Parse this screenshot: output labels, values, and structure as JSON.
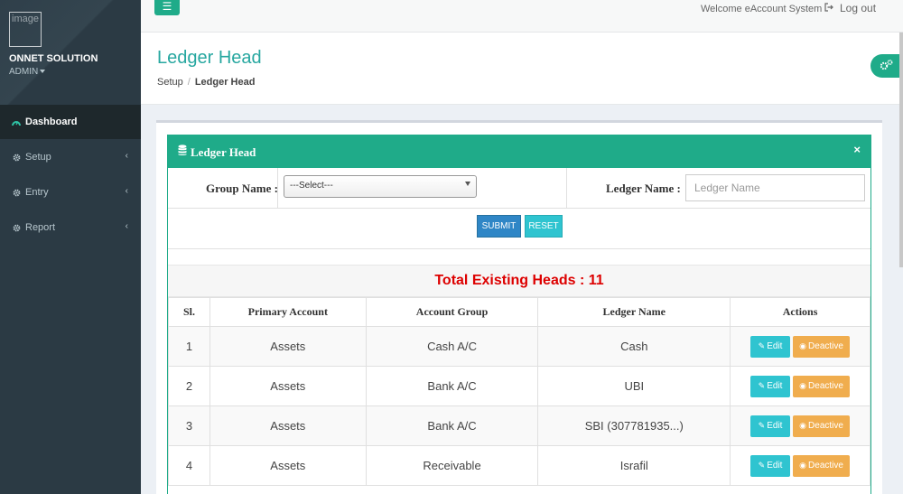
{
  "sidebar": {
    "logo_alt": "image",
    "brand": "ONNET SOLUTION",
    "role": "ADMIN",
    "items": [
      {
        "label": "Dashboard",
        "icon": "dashboard-icon",
        "active": true
      },
      {
        "label": "Setup",
        "icon": "gear-icon"
      },
      {
        "label": "Entry",
        "icon": "gear-icon"
      },
      {
        "label": "Report",
        "icon": "gear-icon"
      }
    ]
  },
  "topbar": {
    "toggle_icon": "hamburger-icon",
    "welcome": "Welcome eAccount System",
    "logout": "Log out"
  },
  "header": {
    "title": "Ledger Head",
    "breadcrumb": {
      "parent": "Setup",
      "current": "Ledger Head"
    }
  },
  "panel": {
    "title": "Ledger Head",
    "close": "×",
    "form": {
      "group_label": "Group Name :",
      "group_selected": "---Select---",
      "ledger_label": "Ledger Name :",
      "ledger_placeholder": "Ledger Name"
    },
    "buttons": {
      "submit": "SUBMIT",
      "reset": "RESET"
    },
    "total": "Total Existing Heads : 11",
    "table": {
      "headers": [
        "Sl.",
        "Primary Account",
        "Account Group",
        "Ledger Name",
        "Actions"
      ],
      "edit_label": "Edit",
      "deactive_label": "Deactive",
      "rows": [
        {
          "sl": "1",
          "primary": "Assets",
          "group": "Cash A/C",
          "ledger": "Cash"
        },
        {
          "sl": "2",
          "primary": "Assets",
          "group": "Bank A/C",
          "ledger": "UBI"
        },
        {
          "sl": "3",
          "primary": "Assets",
          "group": "Bank A/C",
          "ledger": "SBI (307781935...)"
        },
        {
          "sl": "4",
          "primary": "Assets",
          "group": "Receivable",
          "ledger": "Israfil"
        }
      ]
    }
  },
  "colors": {
    "accent": "#1fab89",
    "sidebar": "#2b3a44",
    "title": "#27a7a0",
    "total": "#dd0000"
  }
}
